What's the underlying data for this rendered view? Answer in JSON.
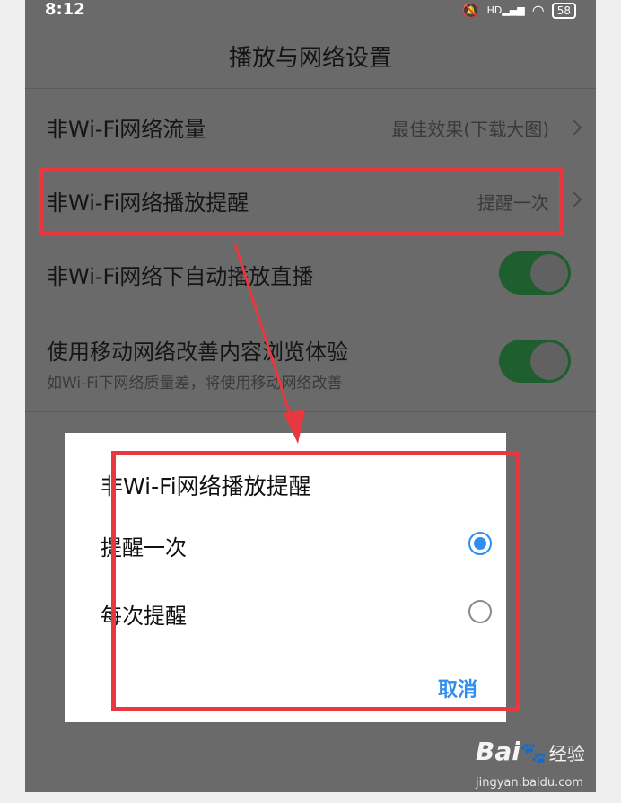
{
  "status_bar": {
    "time": "8:12",
    "battery": "58",
    "signal_label": "HD"
  },
  "header": {
    "title": "播放与网络设置"
  },
  "settings": [
    {
      "label": "非Wi-Fi网络流量",
      "value": "最佳效果(下载大图)"
    },
    {
      "label": "非Wi-Fi网络播放提醒",
      "value": "提醒一次"
    },
    {
      "label": "非Wi-Fi网络下自动播放直播",
      "toggle": true
    },
    {
      "label": "使用移动网络改善内容浏览体验",
      "sublabel": "如Wi-Fi下网络质量差，将使用移动网络改善",
      "toggle": true
    }
  ],
  "dialog": {
    "title": "非Wi-Fi网络播放提醒",
    "options": [
      {
        "label": "提醒一次",
        "selected": true
      },
      {
        "label": "每次提醒",
        "selected": false
      }
    ],
    "cancel_label": "取消"
  },
  "watermark": {
    "brand": "Bai",
    "brand_cn": "经验",
    "url": "jingyan.baidu.com"
  },
  "colors": {
    "annotation": "#e8373e",
    "accent": "#2f8ff0",
    "toggle_on": "#1f5e2f",
    "overlay": "#6a6a6a"
  }
}
